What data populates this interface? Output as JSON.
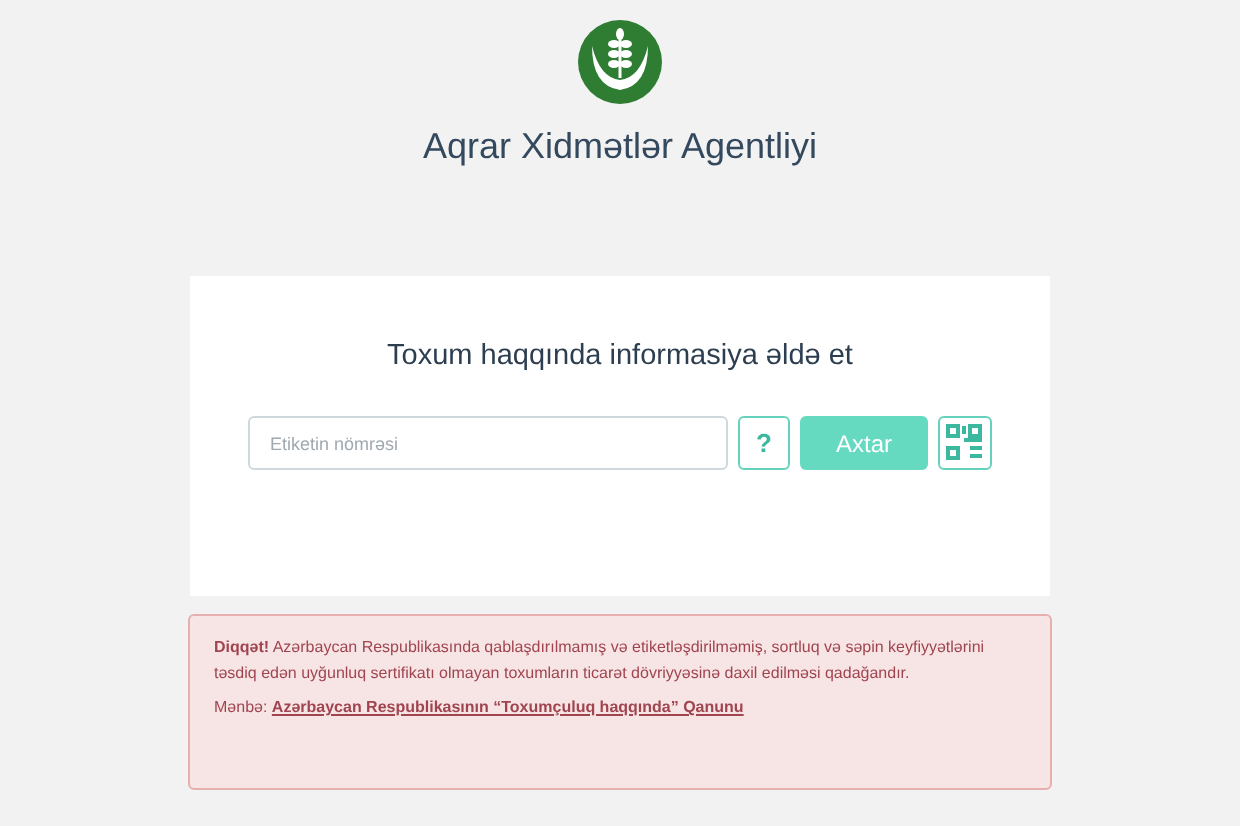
{
  "header": {
    "title": "Aqrar Xidmətlər Agentliyi"
  },
  "search_card": {
    "heading": "Toxum haqqında informasiya əldə et",
    "placeholder": "Etiketin nömrəsi",
    "help_button": "?",
    "search_button": "Axtar"
  },
  "alert": {
    "message": "**Diqqət!** Azərbaycan Respublikasında qablaşdırılmamış və etiketləşdirilməmiş, sortluq və səpin keyfiyyətlərini təsdiq edən uyğunluq sertifikatı olmayan toxumların ticarət dövriyyəsinə daxil edilməsi qadağandır.",
    "source_label": "Mənbə:",
    "source_link": "Azərbaycan Respublikasının “Toxumçuluq haqqında” Qanunu"
  }
}
